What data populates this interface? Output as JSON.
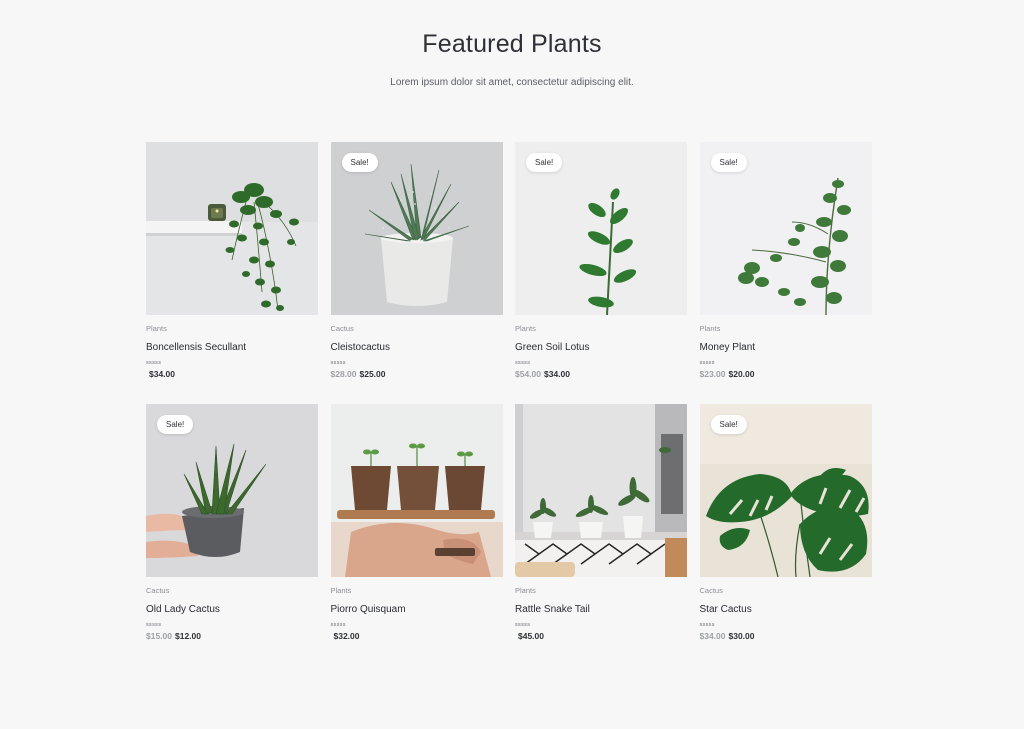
{
  "header": {
    "title": "Featured Plants",
    "subtitle": "Lorem ipsum dolor sit amet, consectetur adipiscing elit."
  },
  "products": [
    {
      "name": "Boncellensis Secullant",
      "category": "Plants",
      "rating": "sssss",
      "price": "$34.00",
      "old_price": "",
      "sale": "",
      "image": "trailing-plant-on-shelf"
    },
    {
      "name": "Cleistocactus",
      "category": "Cactus",
      "rating": "sssss",
      "price": "$25.00",
      "old_price": "$28.00",
      "sale": "Sale!",
      "image": "aloe-in-white-pot"
    },
    {
      "name": "Green Soil Lotus",
      "category": "Plants",
      "rating": "sssss",
      "price": "$34.00",
      "old_price": "$54.00",
      "sale": "Sale!",
      "image": "leafy-stem"
    },
    {
      "name": "Money Plant",
      "category": "Plants",
      "rating": "sssss",
      "price": "$20.00",
      "old_price": "$23.00",
      "sale": "Sale!",
      "image": "eucalyptus-branch"
    },
    {
      "name": "Old Lady Cactus",
      "category": "Cactus",
      "rating": "sssss",
      "price": "$12.00",
      "old_price": "$15.00",
      "sale": "Sale!",
      "image": "snake-plant-held-in-hands"
    },
    {
      "name": "Piorro Quisquam",
      "category": "Plants",
      "rating": "sssss",
      "price": "$32.00",
      "old_price": "",
      "sale": "",
      "image": "seedling-pots-on-tray"
    },
    {
      "name": "Rattle Snake Tail",
      "category": "Plants",
      "rating": "sssss",
      "price": "$45.00",
      "old_price": "",
      "sale": "",
      "image": "room-with-plants"
    },
    {
      "name": "Star Cactus",
      "category": "Cactus",
      "rating": "sssss",
      "price": "$30.00",
      "old_price": "$34.00",
      "sale": "Sale!",
      "image": "monstera-leaves"
    }
  ]
}
